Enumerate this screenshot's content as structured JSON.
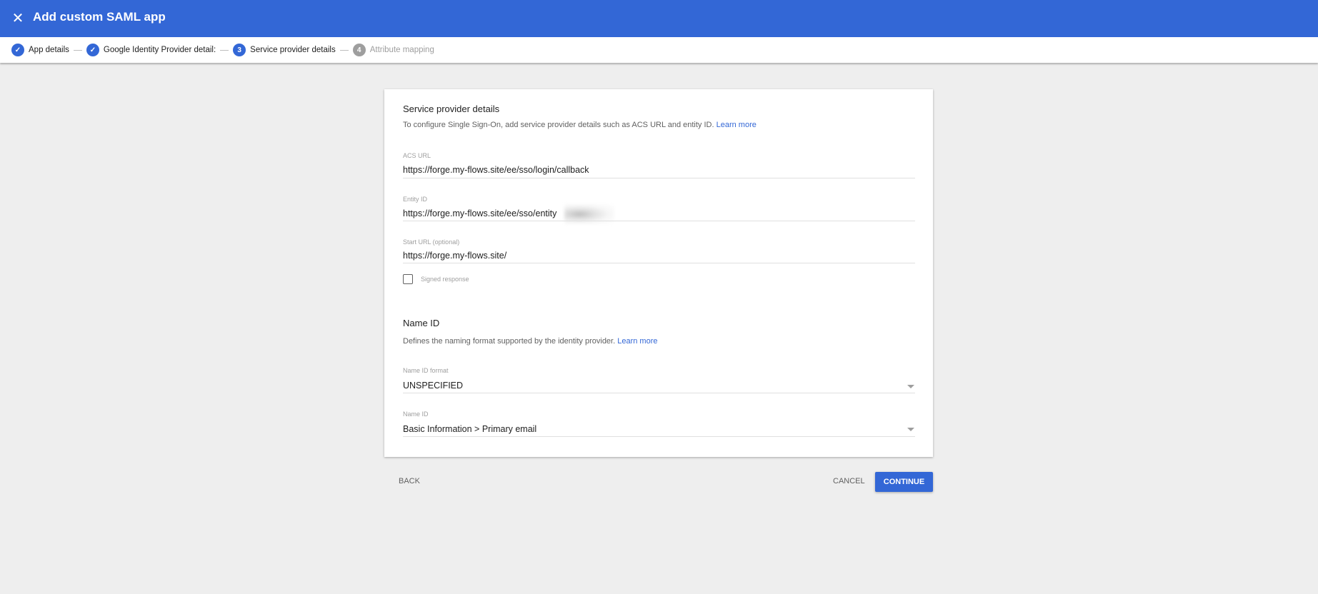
{
  "header": {
    "title": "Add custom SAML app",
    "close_icon": "close-icon",
    "color": "#3367d6"
  },
  "stepper": {
    "steps": [
      {
        "label": "App details",
        "state": "done",
        "icon": "check-icon"
      },
      {
        "label": "Google Identity Provider detail:",
        "state": "done",
        "icon": "check-icon"
      },
      {
        "label": "Service provider details",
        "number": "3",
        "state": "active"
      },
      {
        "label": "Attribute mapping",
        "number": "4",
        "state": "inactive"
      }
    ]
  },
  "card": {
    "title": "Service provider details",
    "description": "To configure Single Sign-On, add service provider details such as ACS URL and entity ID.",
    "learn_more": "Learn more",
    "acs_url": {
      "label": "ACS URL",
      "value": "https://forge.my-flows.site/ee/sso/login/callback"
    },
    "entity_id": {
      "label": "Entity ID",
      "value": "https://forge.my-flows.site/ee/sso/entity"
    },
    "start_url": {
      "label": "Start URL (optional)",
      "value": "https://forge.my-flows.site/"
    },
    "signed_response": {
      "label": "Signed response",
      "checked": false
    },
    "name_id_section": {
      "title": "Name ID",
      "description": "Defines the naming format supported by the identity provider.",
      "learn_more": "Learn more"
    },
    "name_id_format": {
      "label": "Name ID format",
      "value": "UNSPECIFIED"
    },
    "name_id": {
      "label": "Name ID",
      "value": "Basic Information > Primary email"
    }
  },
  "actions": {
    "back": "BACK",
    "cancel": "CANCEL",
    "continue": "CONTINUE"
  }
}
